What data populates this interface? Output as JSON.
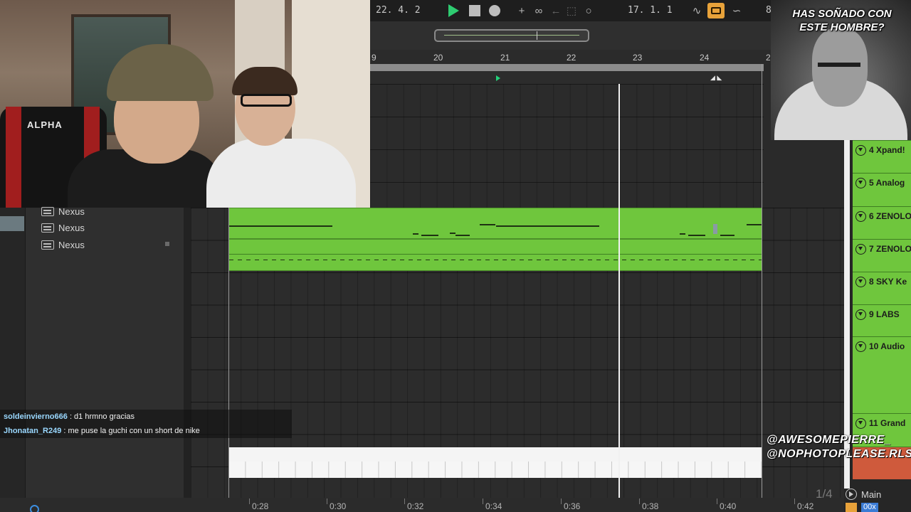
{
  "transport": {
    "arrangement_position": "22.  4.  2",
    "loop_start": "17.  1.  1",
    "right_cut": "8",
    "icons": [
      "play-icon",
      "stop-icon",
      "record-icon",
      "add-icon",
      "link-icon",
      "back-arrow-icon",
      "dotted-square-icon",
      "circle-icon",
      "curve-icon",
      "loop-icon",
      "automation-icon"
    ]
  },
  "ruler": {
    "bars": [
      "9",
      "20",
      "21",
      "22",
      "23",
      "24",
      "2"
    ]
  },
  "webcam": {
    "chair_brand": "ALPHA"
  },
  "tracks": [
    {
      "name": "Nexus"
    },
    {
      "name": "Nexus"
    },
    {
      "name": "Nexus"
    }
  ],
  "time_ruler": [
    "0:28",
    "0:30",
    "0:32",
    "0:34",
    "0:36",
    "0:38",
    "0:40",
    "0:42"
  ],
  "chat": [
    {
      "user": "soldeinvierno666",
      "message": ": d1 hrmno gracias"
    },
    {
      "user": "Jhonatan_R249",
      "message": ": me puse la guchi con un short de nike"
    }
  ],
  "cam2": {
    "caption": "HAS SOÑADO CON ESTE HOMBRE?"
  },
  "mixer": {
    "tracks": [
      "4 Xpand!",
      "5 Analog",
      "6 ZENOLO",
      "7 ZENOLO",
      "8 SKY Ke",
      "9 LABS",
      "10 Audio",
      "11 Grand"
    ],
    "page": "1/4",
    "output": "Main",
    "zoom": "00x"
  },
  "watermarks": [
    "@AWESOMEPIERRE_",
    "@NOPHOTOPLEASE.RLS"
  ],
  "colors": {
    "clip_green": "#6fc63d",
    "play_green": "#2ecc71",
    "loop_orange": "#e8a23a",
    "chat_user": "#9ad8ff"
  }
}
